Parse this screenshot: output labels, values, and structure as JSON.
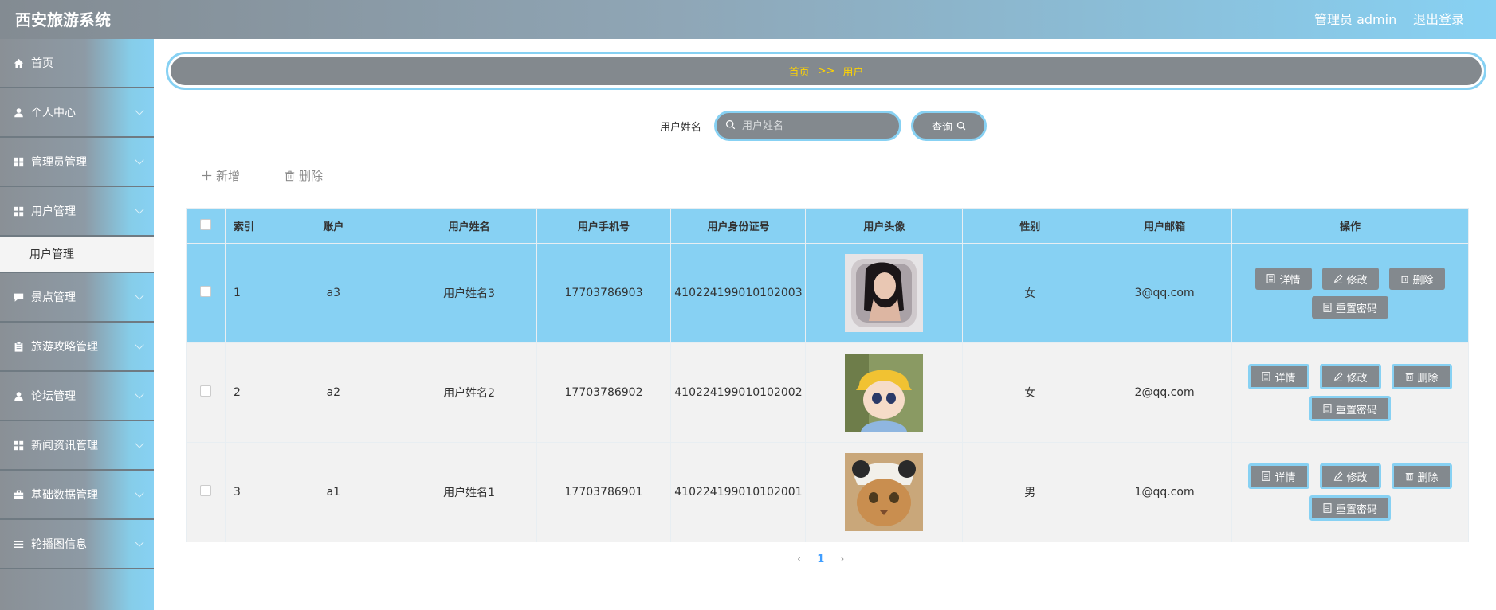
{
  "header": {
    "title": "西安旅游系统",
    "admin": "管理员 admin",
    "logout": "退出登录"
  },
  "sidebar": {
    "items": [
      {
        "label": "首页",
        "icon": "home-icon",
        "chevron": false
      },
      {
        "label": "个人中心",
        "icon": "user-icon",
        "chevron": true
      },
      {
        "label": "管理员管理",
        "icon": "grid-icon",
        "chevron": true
      },
      {
        "label": "用户管理",
        "icon": "grid-icon",
        "chevron": true
      },
      {
        "label": "景点管理",
        "icon": "chat-icon",
        "chevron": true
      },
      {
        "label": "旅游攻略管理",
        "icon": "clipboard-icon",
        "chevron": true
      },
      {
        "label": "论坛管理",
        "icon": "user-icon",
        "chevron": true
      },
      {
        "label": "新闻资讯管理",
        "icon": "grid-icon",
        "chevron": true
      },
      {
        "label": "基础数据管理",
        "icon": "briefcase-icon",
        "chevron": true
      },
      {
        "label": "轮播图信息",
        "icon": "list-icon",
        "chevron": true
      }
    ],
    "submenu_label": "用户管理"
  },
  "breadcrumb": {
    "home": "首页",
    "sep": ">>",
    "current": "用户"
  },
  "search": {
    "label": "用户姓名",
    "placeholder": "用户姓名",
    "button": "查询"
  },
  "actions": {
    "add": "新增",
    "delete": "删除"
  },
  "table": {
    "headers": [
      "索引",
      "账户",
      "用户姓名",
      "用户手机号",
      "用户身份证号",
      "用户头像",
      "性别",
      "用户邮箱",
      "操作"
    ],
    "rows": [
      {
        "index": "1",
        "account": "a3",
        "name": "用户姓名3",
        "phone": "17703786903",
        "idcard": "410224199010102003",
        "gender": "女",
        "email": "3@qq.com"
      },
      {
        "index": "2",
        "account": "a2",
        "name": "用户姓名2",
        "phone": "17703786902",
        "idcard": "410224199010102002",
        "gender": "女",
        "email": "2@qq.com"
      },
      {
        "index": "3",
        "account": "a1",
        "name": "用户姓名1",
        "phone": "17703786901",
        "idcard": "410224199010102001",
        "gender": "男",
        "email": "1@qq.com"
      }
    ],
    "ops": {
      "detail": "详情",
      "edit": "修改",
      "delete": "删除",
      "reset": "重置密码"
    }
  },
  "pagination": {
    "current": "1"
  },
  "colors": {
    "accent": "#87d1f3",
    "gray": "#83898e",
    "breadcrumb_text": "#ffd400"
  }
}
